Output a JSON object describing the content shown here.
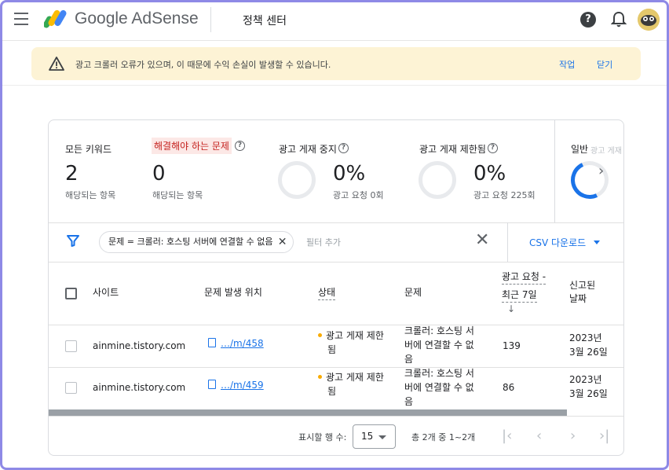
{
  "header": {
    "brand": "Google AdSense",
    "page_title": "정책 센터",
    "help": "?"
  },
  "alert": {
    "message": "광고 크롤러 오류가 있으며, 이 때문에 수익 손실이 발생할 수 있습니다.",
    "action": "작업",
    "close": "닫기"
  },
  "stats": {
    "all_keywords": {
      "label": "모든 키워드",
      "value": "2",
      "sub": "해당되는 항목"
    },
    "issues": {
      "label": "해결해야 하는 문제",
      "value": "0",
      "sub": "해당되는 항목"
    },
    "paused": {
      "label": "광고 게재 중지",
      "value": "0%",
      "sub": "광고 요청 0회"
    },
    "limited": {
      "label": "광고 게재 제한됨",
      "value": "0%",
      "sub": "광고 요청 225회"
    },
    "general": {
      "label": "일반",
      "faded": "광고 게재"
    }
  },
  "filter": {
    "chip": "문제 = 크롤러: 호스팅 서버에 연결할 수 없음",
    "add_placeholder": "필터 추가",
    "csv": "CSV 다운로드"
  },
  "table": {
    "headers": {
      "site": "사이트",
      "location": "문제 발생 위치",
      "status": "상태",
      "issue": "문제",
      "requests_1": "광고 요청 -",
      "requests_2": "최근 7일",
      "reported_1": "신고된",
      "reported_2": "날짜",
      "sort_arrow": "↓"
    },
    "rows": [
      {
        "site": "ainmine.tistory.com",
        "location": "…/m/458",
        "status_1": "광고 게재 제한",
        "status_2": "됨",
        "issue_1": "크롤러: 호스팅 서",
        "issue_2": "버에 연결할 수 없",
        "issue_3": "음",
        "requests": "139",
        "date_1": "2023년",
        "date_2": "3월 26일"
      },
      {
        "site": "ainmine.tistory.com",
        "location": "…/m/459",
        "status_1": "광고 게재 제한",
        "status_2": "됨",
        "issue_1": "크롤러: 호스팅 서",
        "issue_2": "버에 연결할 수 없",
        "issue_3": "음",
        "requests": "86",
        "date_1": "2023년",
        "date_2": "3월 26일"
      }
    ]
  },
  "pager": {
    "rows_label": "표시할 행 수:",
    "rows_value": "15",
    "count": "총 2개 중 1~2개"
  },
  "colors": {
    "accent": "#1a73e8",
    "alert_bg": "#fdf3d5",
    "issue_highlight": "#fce8e6",
    "status_dot": "#f9ab00",
    "frame": "#8e89e6"
  }
}
